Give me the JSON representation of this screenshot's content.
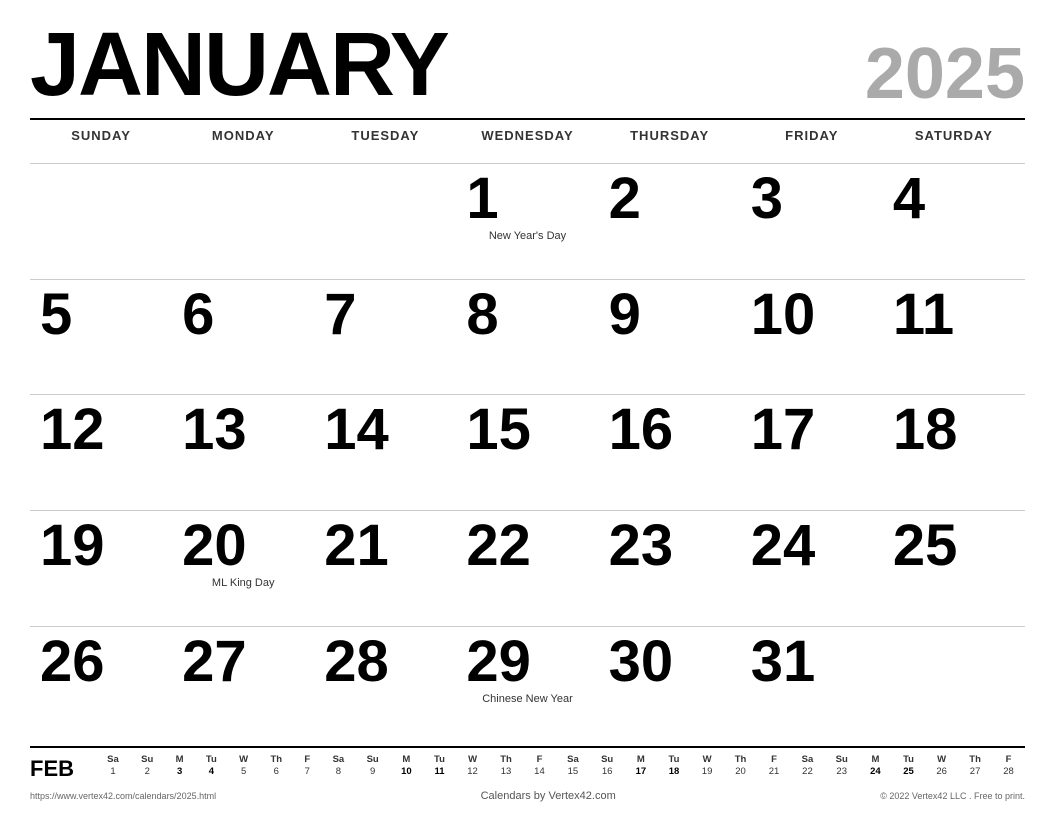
{
  "header": {
    "month": "JANUARY",
    "year": "2025"
  },
  "days_of_week": [
    "SUNDAY",
    "MONDAY",
    "TUESDAY",
    "WEDNESDAY",
    "THURSDAY",
    "FRIDAY",
    "SATURDAY"
  ],
  "weeks": [
    [
      {
        "day": "",
        "holiday": ""
      },
      {
        "day": "",
        "holiday": ""
      },
      {
        "day": "",
        "holiday": ""
      },
      {
        "day": "1",
        "holiday": "New Year's Day"
      },
      {
        "day": "2",
        "holiday": ""
      },
      {
        "day": "3",
        "holiday": ""
      },
      {
        "day": "4",
        "holiday": ""
      }
    ],
    [
      {
        "day": "5",
        "holiday": ""
      },
      {
        "day": "6",
        "holiday": ""
      },
      {
        "day": "7",
        "holiday": ""
      },
      {
        "day": "8",
        "holiday": ""
      },
      {
        "day": "9",
        "holiday": ""
      },
      {
        "day": "10",
        "holiday": ""
      },
      {
        "day": "11",
        "holiday": ""
      }
    ],
    [
      {
        "day": "12",
        "holiday": ""
      },
      {
        "day": "13",
        "holiday": ""
      },
      {
        "day": "14",
        "holiday": ""
      },
      {
        "day": "15",
        "holiday": ""
      },
      {
        "day": "16",
        "holiday": ""
      },
      {
        "day": "17",
        "holiday": ""
      },
      {
        "day": "18",
        "holiday": ""
      }
    ],
    [
      {
        "day": "19",
        "holiday": ""
      },
      {
        "day": "20",
        "holiday": "ML King Day"
      },
      {
        "day": "21",
        "holiday": ""
      },
      {
        "day": "22",
        "holiday": ""
      },
      {
        "day": "23",
        "holiday": ""
      },
      {
        "day": "24",
        "holiday": ""
      },
      {
        "day": "25",
        "holiday": ""
      }
    ],
    [
      {
        "day": "26",
        "holiday": ""
      },
      {
        "day": "27",
        "holiday": ""
      },
      {
        "day": "28",
        "holiday": ""
      },
      {
        "day": "29",
        "holiday": "Chinese New Year"
      },
      {
        "day": "30",
        "holiday": ""
      },
      {
        "day": "31",
        "holiday": ""
      },
      {
        "day": "",
        "holiday": ""
      }
    ]
  ],
  "mini_calendar": {
    "month_label": "FEB",
    "headers": [
      "Sa",
      "Su",
      "M",
      "Tu",
      "W",
      "Th",
      "F",
      "Sa",
      "Su",
      "M",
      "Tu",
      "W",
      "Th",
      "F",
      "Sa",
      "Su",
      "M",
      "Tu",
      "W",
      "Th",
      "F",
      "Sa",
      "Su",
      "M",
      "Tu",
      "W",
      "Th",
      "F"
    ],
    "days": [
      "1",
      "2",
      "3",
      "4",
      "5",
      "6",
      "7",
      "8",
      "9",
      "10",
      "11",
      "12",
      "13",
      "14",
      "15",
      "16",
      "17",
      "18",
      "19",
      "20",
      "21",
      "22",
      "23",
      "24",
      "25",
      "26",
      "27",
      "28"
    ],
    "bold_days": [
      "3",
      "4",
      "10",
      "11",
      "17",
      "18",
      "24",
      "25"
    ]
  },
  "footer": {
    "left": "https://www.vertex42.com/calendars/2025.html",
    "center": "Calendars by Vertex42.com",
    "right": "© 2022 Vertex42 LLC . Free to print."
  }
}
